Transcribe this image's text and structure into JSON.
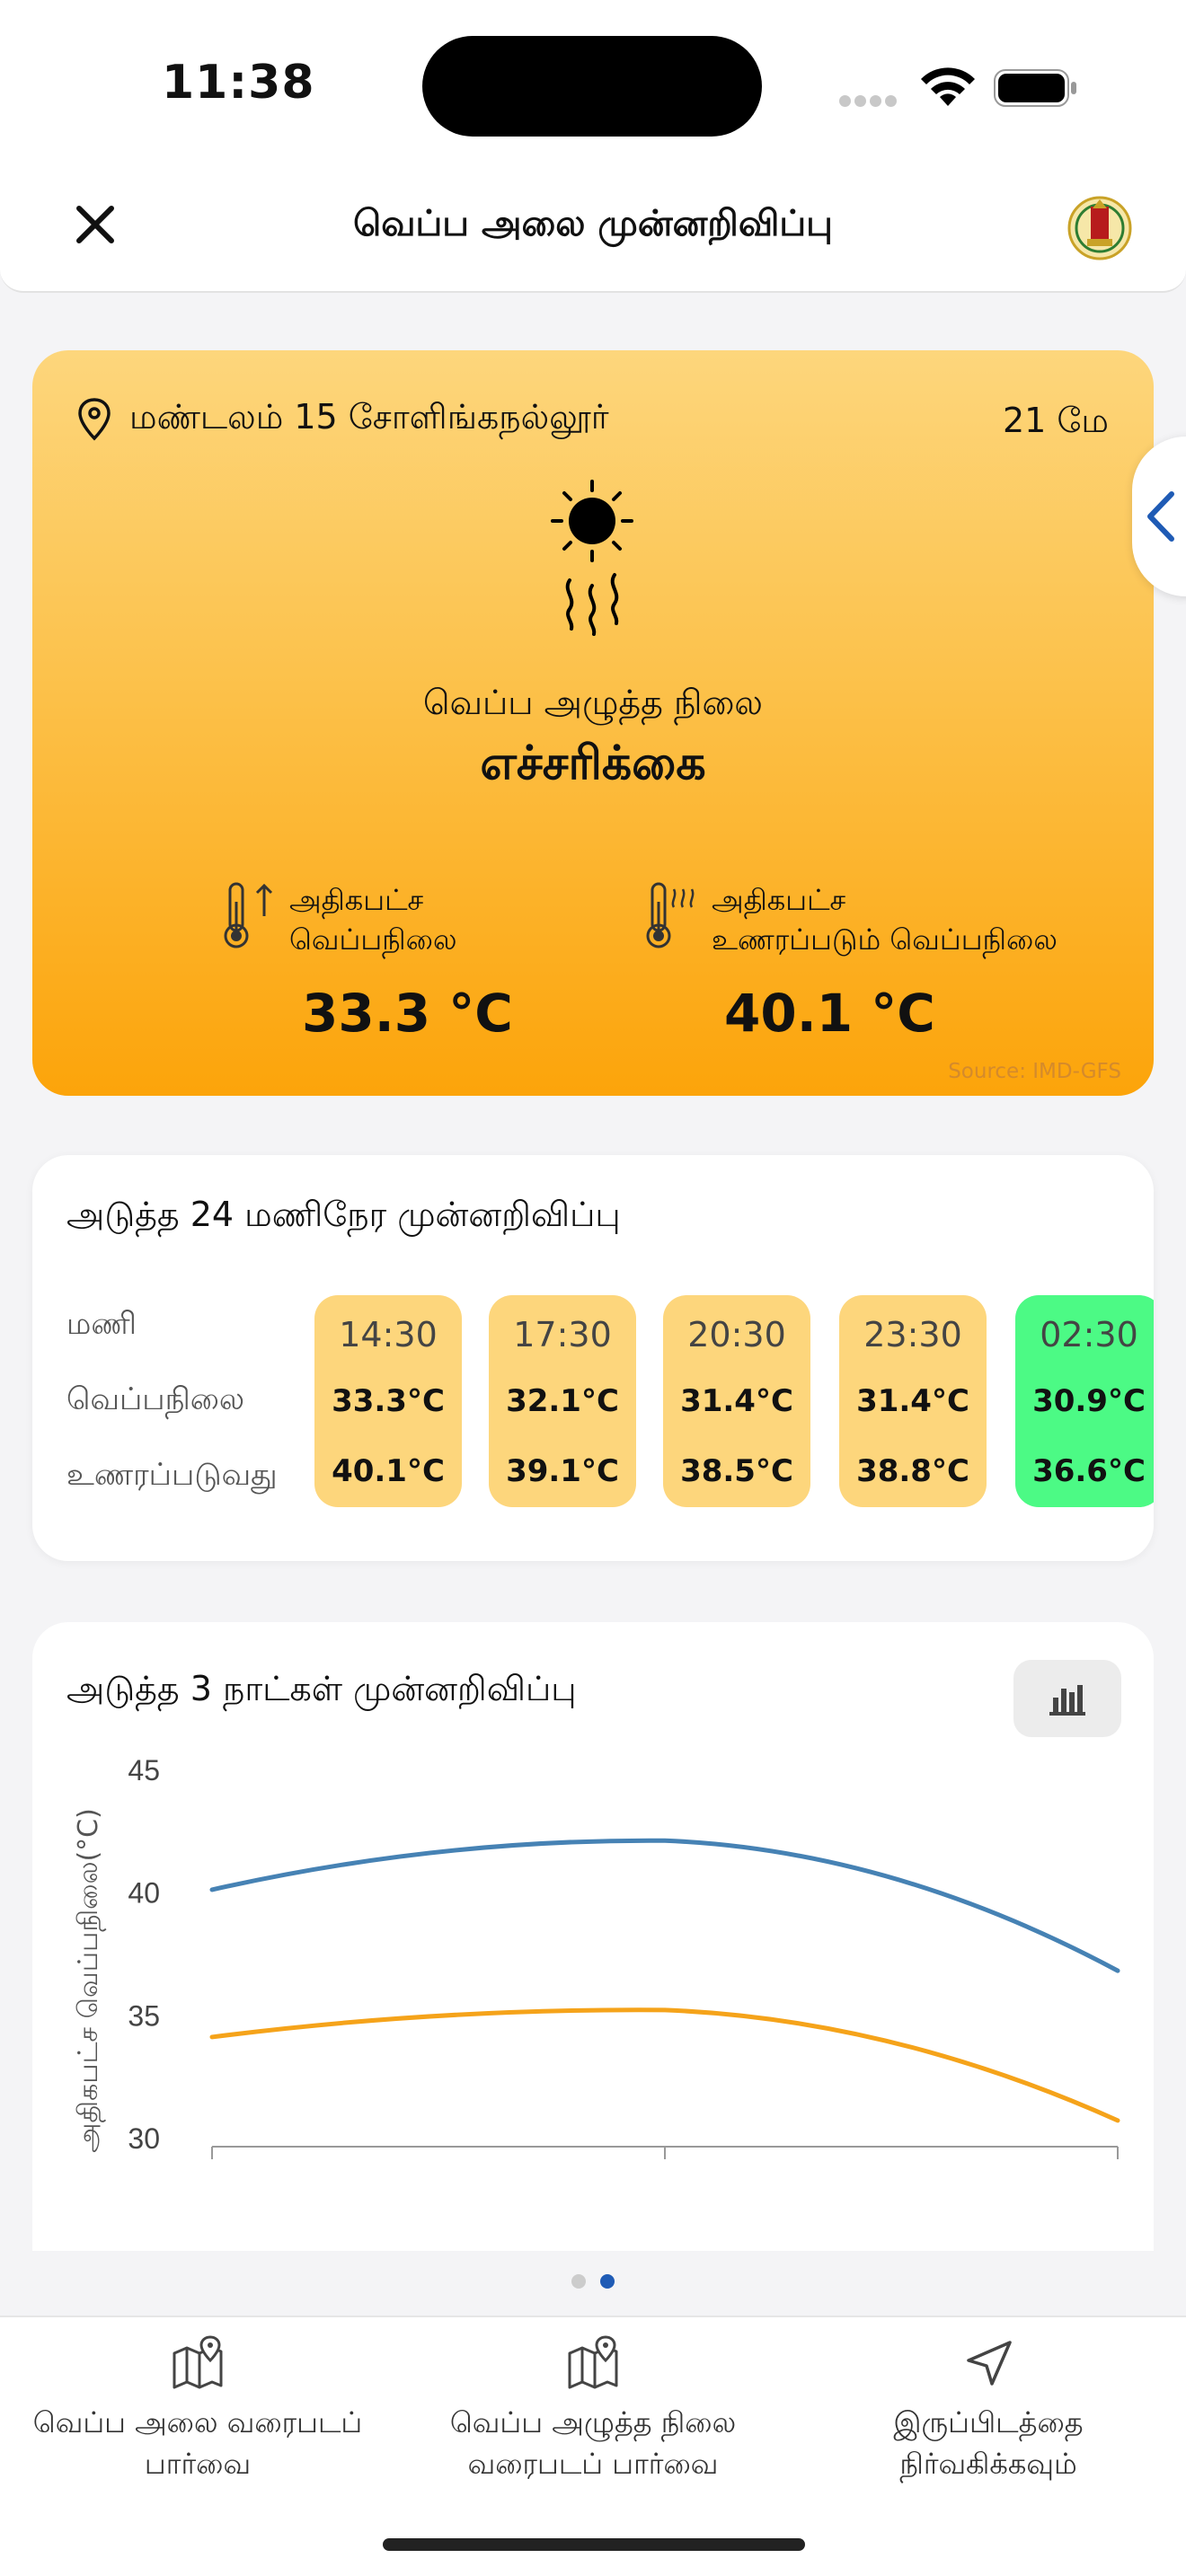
{
  "status_bar": {
    "time": "11:38"
  },
  "header": {
    "title": "வெப்ப அலை முன்னறிவிப்பு"
  },
  "heat_card": {
    "location": "மண்டலம் 15 சோளிங்கநல்லூர்",
    "date": "21 மே",
    "stress_label": "வெப்ப அழுத்த நிலை",
    "stress_value": "எச்சரிக்கை",
    "max_temp_label_1": "அதிகபட்ச",
    "max_temp_label_2": "வெப்பநிலை",
    "max_temp_value": "33.3 °C",
    "feels_label_1": "அதிகபட்ச",
    "feels_label_2": "உணரப்படும் வெப்பநிலை",
    "feels_value": "40.1 °C",
    "source": "Source: IMD-GFS",
    "colors": {
      "top": "#fdd67c",
      "bottom": "#fca40a"
    }
  },
  "hourly": {
    "title": "அடுத்த 24 மணிநேர முன்னறிவிப்பு",
    "row_labels": {
      "hour": "மணி",
      "temp": "வெப்பநிலை",
      "feels": "உணரப்படுவது"
    },
    "columns": [
      {
        "time": "14:30",
        "temp": "33.3°C",
        "feels": "40.1°C",
        "level": "warning"
      },
      {
        "time": "17:30",
        "temp": "32.1°C",
        "feels": "39.1°C",
        "level": "warning"
      },
      {
        "time": "20:30",
        "temp": "31.4°C",
        "feels": "38.5°C",
        "level": "warning"
      },
      {
        "time": "23:30",
        "temp": "31.4°C",
        "feels": "38.8°C",
        "level": "warning"
      },
      {
        "time": "02:30",
        "temp": "30.9°C",
        "feels": "36.6°C",
        "level": "safe"
      }
    ],
    "colors": {
      "warning": "#fdd67c",
      "safe": "#4cfa85"
    }
  },
  "daily": {
    "title": "அடுத்த 3 நாட்கள் முன்னறிவிப்பு"
  },
  "chart_data": {
    "type": "line",
    "x": [
      0,
      1,
      2
    ],
    "series": [
      {
        "values": [
          40.1,
          42.1,
          36.8
        ],
        "color": "#4682b4"
      },
      {
        "values": [
          34.1,
          35.2,
          30.7
        ],
        "color": "#f5a31a"
      }
    ],
    "ylabel": "அதிகபட்ச வெப்பநிலை(°C)",
    "yticks": [
      30,
      35,
      40,
      45
    ],
    "ylim": [
      30,
      45
    ]
  },
  "pager": {
    "count": 2,
    "active": 1
  },
  "bottom_nav": {
    "items": [
      {
        "line1": "வெப்ப அலை வரைபடப்",
        "line2": "பார்வை",
        "icon": "map-pin-icon"
      },
      {
        "line1": "வெப்ப அழுத்த நிலை",
        "line2": "வரைபடப் பார்வை",
        "icon": "map-pin-icon"
      },
      {
        "line1": "இருப்பிடத்தை",
        "line2": "நிர்வகிக்கவும்",
        "icon": "navigation-arrow-icon"
      }
    ]
  }
}
